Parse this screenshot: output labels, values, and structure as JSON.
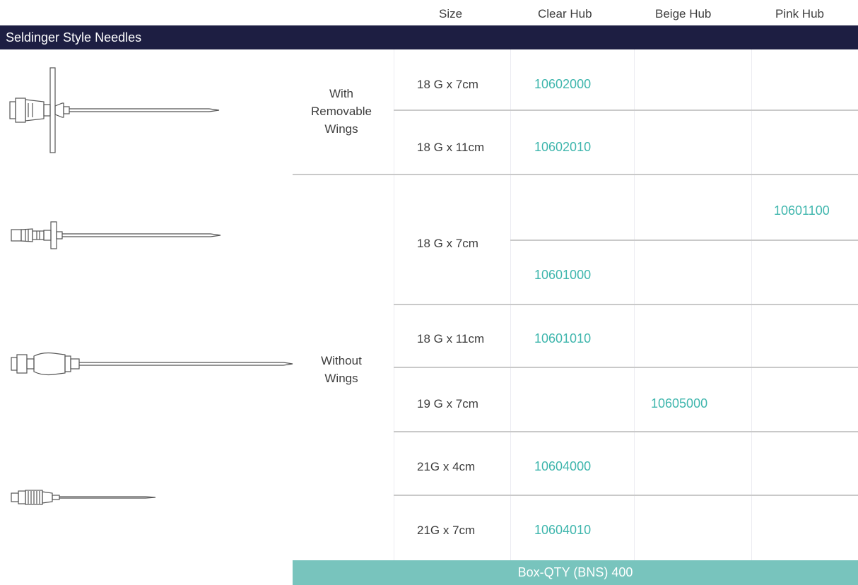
{
  "table": {
    "headers": {
      "size": "Size",
      "clear_hub": "Clear Hub",
      "beige_hub": "Beige Hub",
      "pink_hub": "Pink Hub"
    },
    "title": "Seldinger Style Needles",
    "groups": {
      "with_wings": [
        "With",
        "Removable",
        "Wings"
      ],
      "without_wings": [
        "Without",
        "Wings"
      ]
    },
    "rows": [
      {
        "size": "18 G x 7cm",
        "clear": "10602000"
      },
      {
        "size": "18 G x 11cm",
        "clear": "10602010"
      },
      {
        "size": "18 G x 7cm",
        "pink": "10601100",
        "clear": "10601000"
      },
      {
        "size": "18 G x 11cm",
        "clear": "10601010"
      },
      {
        "size": "19 G x 7cm",
        "beige": "10605000"
      },
      {
        "size": "21G x 4cm",
        "clear": "10604000"
      },
      {
        "size": "21G x 7cm",
        "clear": "10604010"
      }
    ],
    "footer": "Box-QTY (BNS) 400"
  },
  "colors": {
    "title_bar": "#1d1e42",
    "code_text": "#3fb6ad",
    "footer_bar": "#78c4bd"
  },
  "icons": [
    "winged-needle-icon",
    "short-hub-needle-icon",
    "long-needle-icon",
    "small-needle-icon"
  ]
}
